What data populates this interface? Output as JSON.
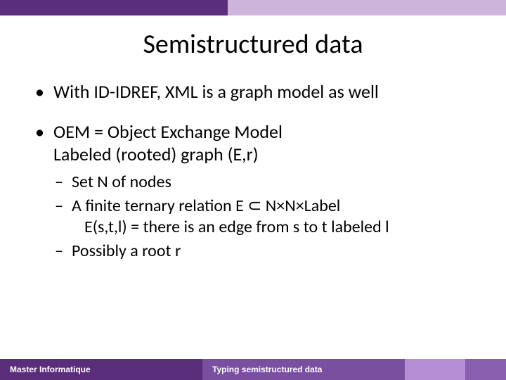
{
  "title": "Semistructured data",
  "bullets": {
    "b1": "With ID-IDREF, XML is a graph model as well",
    "b2_line1": "OEM = Object Exchange Model",
    "b2_line2": "Labeled (rooted) graph (E,r)",
    "s1": "Set N of nodes",
    "s2": "A finite ternary relation E ⊂ N×N×Label",
    "s2b": "E(s,t,l) = there is an edge from s to t labeled l",
    "s3": "Possibly a root r"
  },
  "footer": {
    "left": "Master Informatique",
    "right": "Typing semistructured data"
  }
}
